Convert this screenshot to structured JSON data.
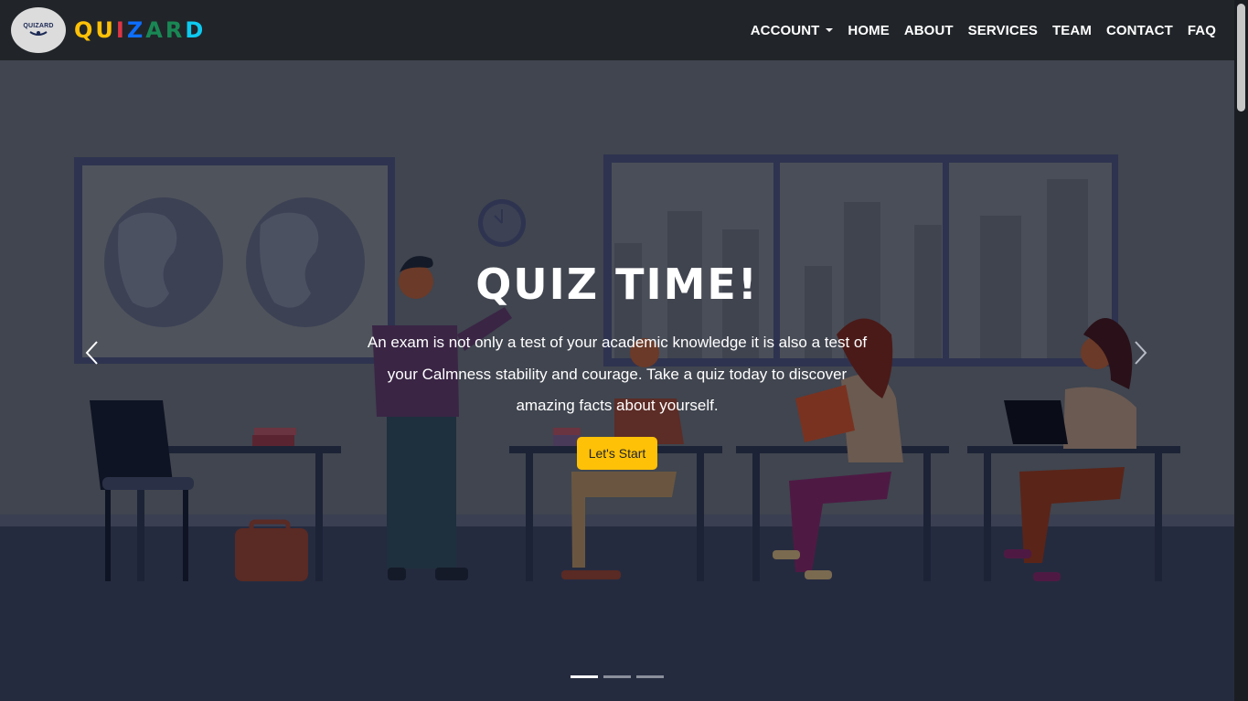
{
  "brand": {
    "logo_text": "QUIZARD",
    "name_letters": [
      {
        "ch": "Q",
        "color": "#ffc107"
      },
      {
        "ch": "U",
        "color": "#ffc107"
      },
      {
        "ch": "I",
        "color": "#dc3545"
      },
      {
        "ch": "Z",
        "color": "#0d6efd"
      },
      {
        "ch": "A",
        "color": "#198754"
      },
      {
        "ch": "R",
        "color": "#198754"
      },
      {
        "ch": "D",
        "color": "#0dcaf0"
      }
    ]
  },
  "nav": {
    "account": "ACCOUNT",
    "home": "HOME",
    "about": "ABOUT",
    "services": "SERVICES",
    "team": "TEAM",
    "contact": "CONTACT",
    "faq": "FAQ"
  },
  "hero": {
    "title": "QUIZ TIME!",
    "text": "An exam is not only a test of your academic knowledge it is also a test of your Calmness stability and courage. Take a quiz today to discover amazing facts about yourself.",
    "button": "Let's Start",
    "slides": 3,
    "active_slide": 1
  },
  "colors": {
    "navbar": "#212529",
    "accent": "#ffc107"
  },
  "icons": {
    "prev": "chevron-left-icon",
    "next": "chevron-right-icon",
    "account_caret": "caret-down-icon"
  }
}
